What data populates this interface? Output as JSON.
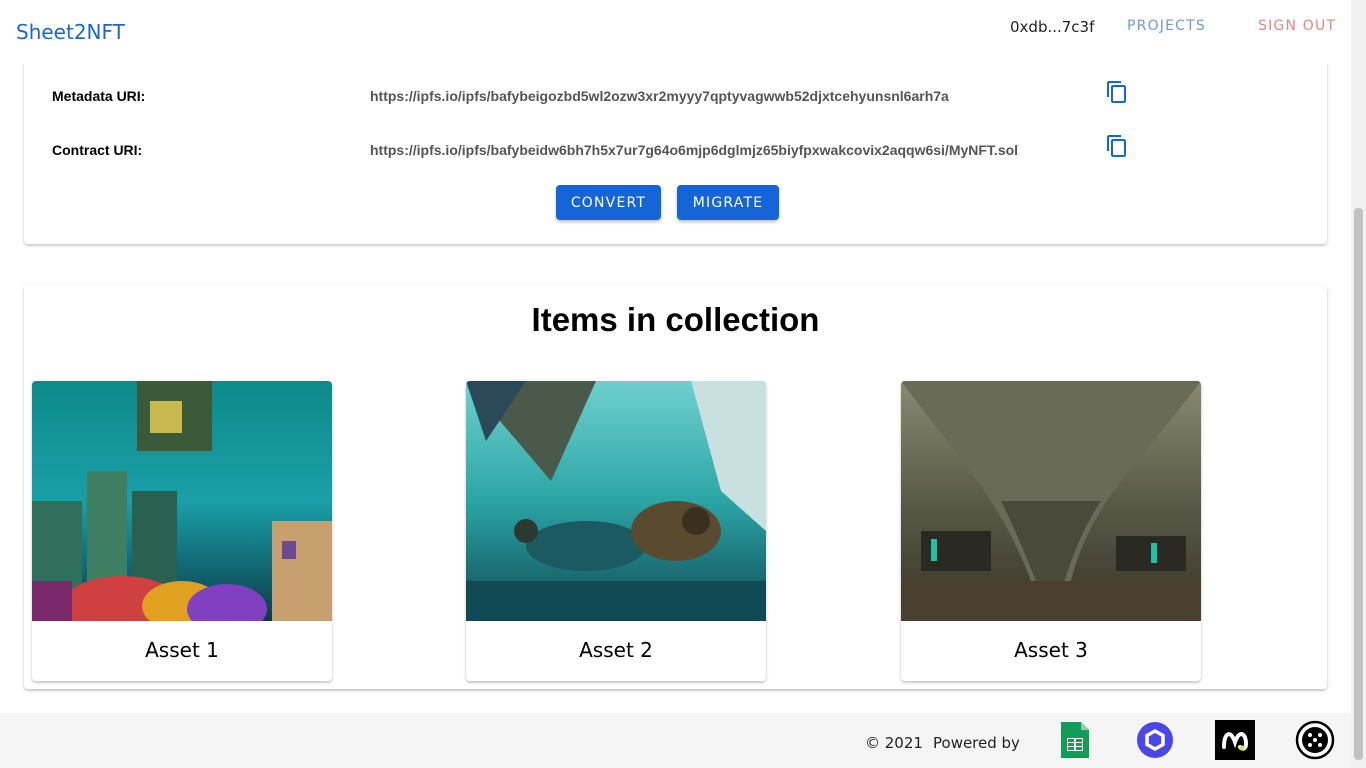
{
  "header": {
    "brand": "Sheet2NFT",
    "wallet": "0xdb...7c3f",
    "projects_label": "PROJECTS",
    "signout_label": "SIGN OUT"
  },
  "info": {
    "metadata_label": "Metadata URI:",
    "metadata_value": "https://ipfs.io/ipfs/bafybeigozbd5wl2ozw3xr2myyy7qptyvagwwb52djxtcehyunsnl6arh7a",
    "contract_label": "Contract URI:",
    "contract_value": "https://ipfs.io/ipfs/bafybeidw6bh7h5x7ur7g64o6mjp6dglmjz65biyfpxwakcovix2aqqw6si/MyNFT.sol",
    "copy_icon": "copy-icon",
    "convert_label": "CONVERT",
    "migrate_label": "MIGRATE"
  },
  "collection": {
    "title": "Items in collection",
    "assets": [
      {
        "label": "Asset 1"
      },
      {
        "label": "Asset 2"
      },
      {
        "label": "Asset 3"
      }
    ]
  },
  "footer": {
    "copyright": "© 2021",
    "powered_by": "Powered by",
    "logos": [
      "google-sheets-logo",
      "chainlink-logo",
      "moralis-logo",
      "filecoin-logo"
    ]
  },
  "colors": {
    "brand": "#1a66d1",
    "primary_button": "#1565d8",
    "projects": "#6e9ad9",
    "signout": "#e58484"
  }
}
